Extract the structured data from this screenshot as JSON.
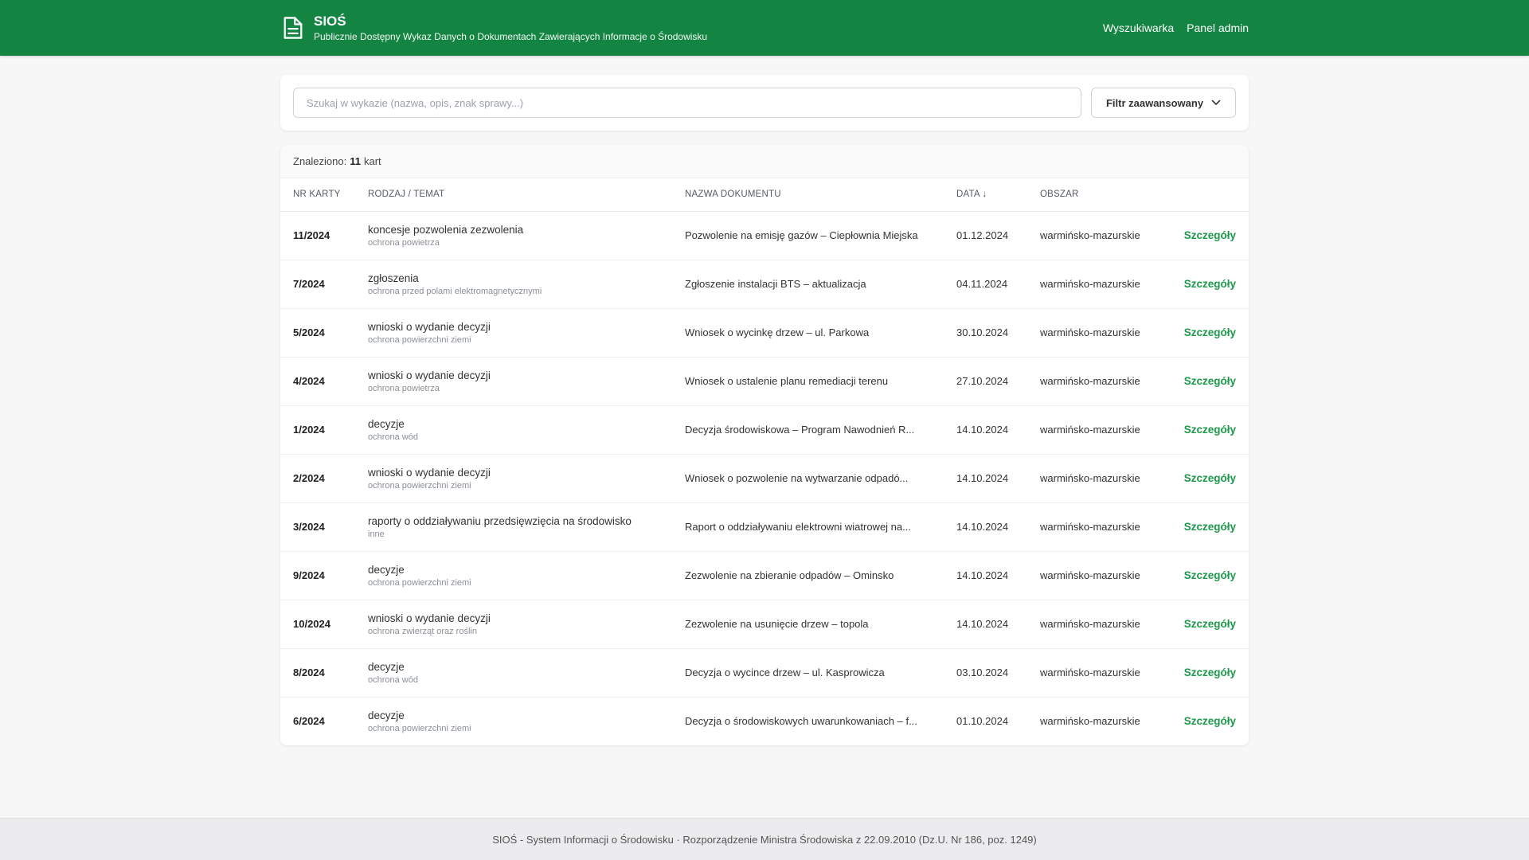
{
  "header": {
    "icon": "document-icon",
    "title": "SIOŚ",
    "subtitle": "Publicznie Dostępny Wykaz Danych o Dokumentach Zawierających Informacje o Środowisku",
    "nav": [
      "Wyszukiwarka",
      "Panel admin"
    ],
    "brand_color": "#148443"
  },
  "search": {
    "placeholder": "Szukaj w wykazie (nazwa, opis, znak sprawy...)",
    "value": "",
    "filter_label": "Filtr zaawansowany"
  },
  "results": {
    "found_prefix": "Znaleziono:",
    "count": "11",
    "found_suffix": "kart",
    "columns": [
      "NR KARTY",
      "RODZAJ / TEMAT",
      "NAZWA DOKUMENTU",
      "DATA ↓",
      "OBSZAR",
      ""
    ],
    "details_label": "Szczegóły",
    "rows": [
      {
        "nr": "11/2024",
        "rodzaj": "koncesje pozwolenia zezwolenia",
        "temat": "ochrona powietrza",
        "nazwa": "Pozwolenie na emisję gazów – Ciepłownia Miejska",
        "data": "01.12.2024",
        "obszar": "warmińsko-mazurskie"
      },
      {
        "nr": "7/2024",
        "rodzaj": "zgłoszenia",
        "temat": "ochrona przed polami elektromagnetycznymi",
        "nazwa": "Zgłoszenie instalacji BTS – aktualizacja",
        "data": "04.11.2024",
        "obszar": "warmińsko-mazurskie"
      },
      {
        "nr": "5/2024",
        "rodzaj": "wnioski o wydanie decyzji",
        "temat": "ochrona powierzchni ziemi",
        "nazwa": "Wniosek o wycinkę drzew – ul. Parkowa",
        "data": "30.10.2024",
        "obszar": "warmińsko-mazurskie"
      },
      {
        "nr": "4/2024",
        "rodzaj": "wnioski o wydanie decyzji",
        "temat": "ochrona powietrza",
        "nazwa": "Wniosek o ustalenie planu remediacji terenu",
        "data": "27.10.2024",
        "obszar": "warmińsko-mazurskie"
      },
      {
        "nr": "1/2024",
        "rodzaj": "decyzje",
        "temat": "ochrona wód",
        "nazwa": "Decyzja środowiskowa – Program Nawodnień R...",
        "data": "14.10.2024",
        "obszar": "warmińsko-mazurskie"
      },
      {
        "nr": "2/2024",
        "rodzaj": "wnioski o wydanie decyzji",
        "temat": "ochrona powierzchni ziemi",
        "nazwa": "Wniosek o pozwolenie na wytwarzanie odpadó...",
        "data": "14.10.2024",
        "obszar": "warmińsko-mazurskie"
      },
      {
        "nr": "3/2024",
        "rodzaj": "raporty o oddziaływaniu przedsięwzięcia na środowisko",
        "temat": "inne",
        "nazwa": "Raport o oddziaływaniu elektrowni wiatrowej na...",
        "data": "14.10.2024",
        "obszar": "warmińsko-mazurskie"
      },
      {
        "nr": "9/2024",
        "rodzaj": "decyzje",
        "temat": "ochrona powierzchni ziemi",
        "nazwa": "Zezwolenie na zbieranie odpadów – Ominsko",
        "data": "14.10.2024",
        "obszar": "warmińsko-mazurskie"
      },
      {
        "nr": "10/2024",
        "rodzaj": "wnioski o wydanie decyzji",
        "temat": "ochrona zwierząt oraz roślin",
        "nazwa": "Zezwolenie na usunięcie drzew – topola",
        "data": "14.10.2024",
        "obszar": "warmińsko-mazurskie"
      },
      {
        "nr": "8/2024",
        "rodzaj": "decyzje",
        "temat": "ochrona wód",
        "nazwa": "Decyzja o wycince drzew – ul. Kasprowicza",
        "data": "03.10.2024",
        "obszar": "warmińsko-mazurskie"
      },
      {
        "nr": "6/2024",
        "rodzaj": "decyzje",
        "temat": "ochrona powierzchni ziemi",
        "nazwa": "Decyzja o środowiskowych uwarunkowaniach – f...",
        "data": "01.10.2024",
        "obszar": "warmińsko-mazurskie"
      }
    ]
  },
  "footer": {
    "text": "SIOŚ - System Informacji o Środowisku · Rozporządzenie Ministra Środowiska z 22.09.2010 (Dz.U. Nr 186, poz. 1249)"
  }
}
